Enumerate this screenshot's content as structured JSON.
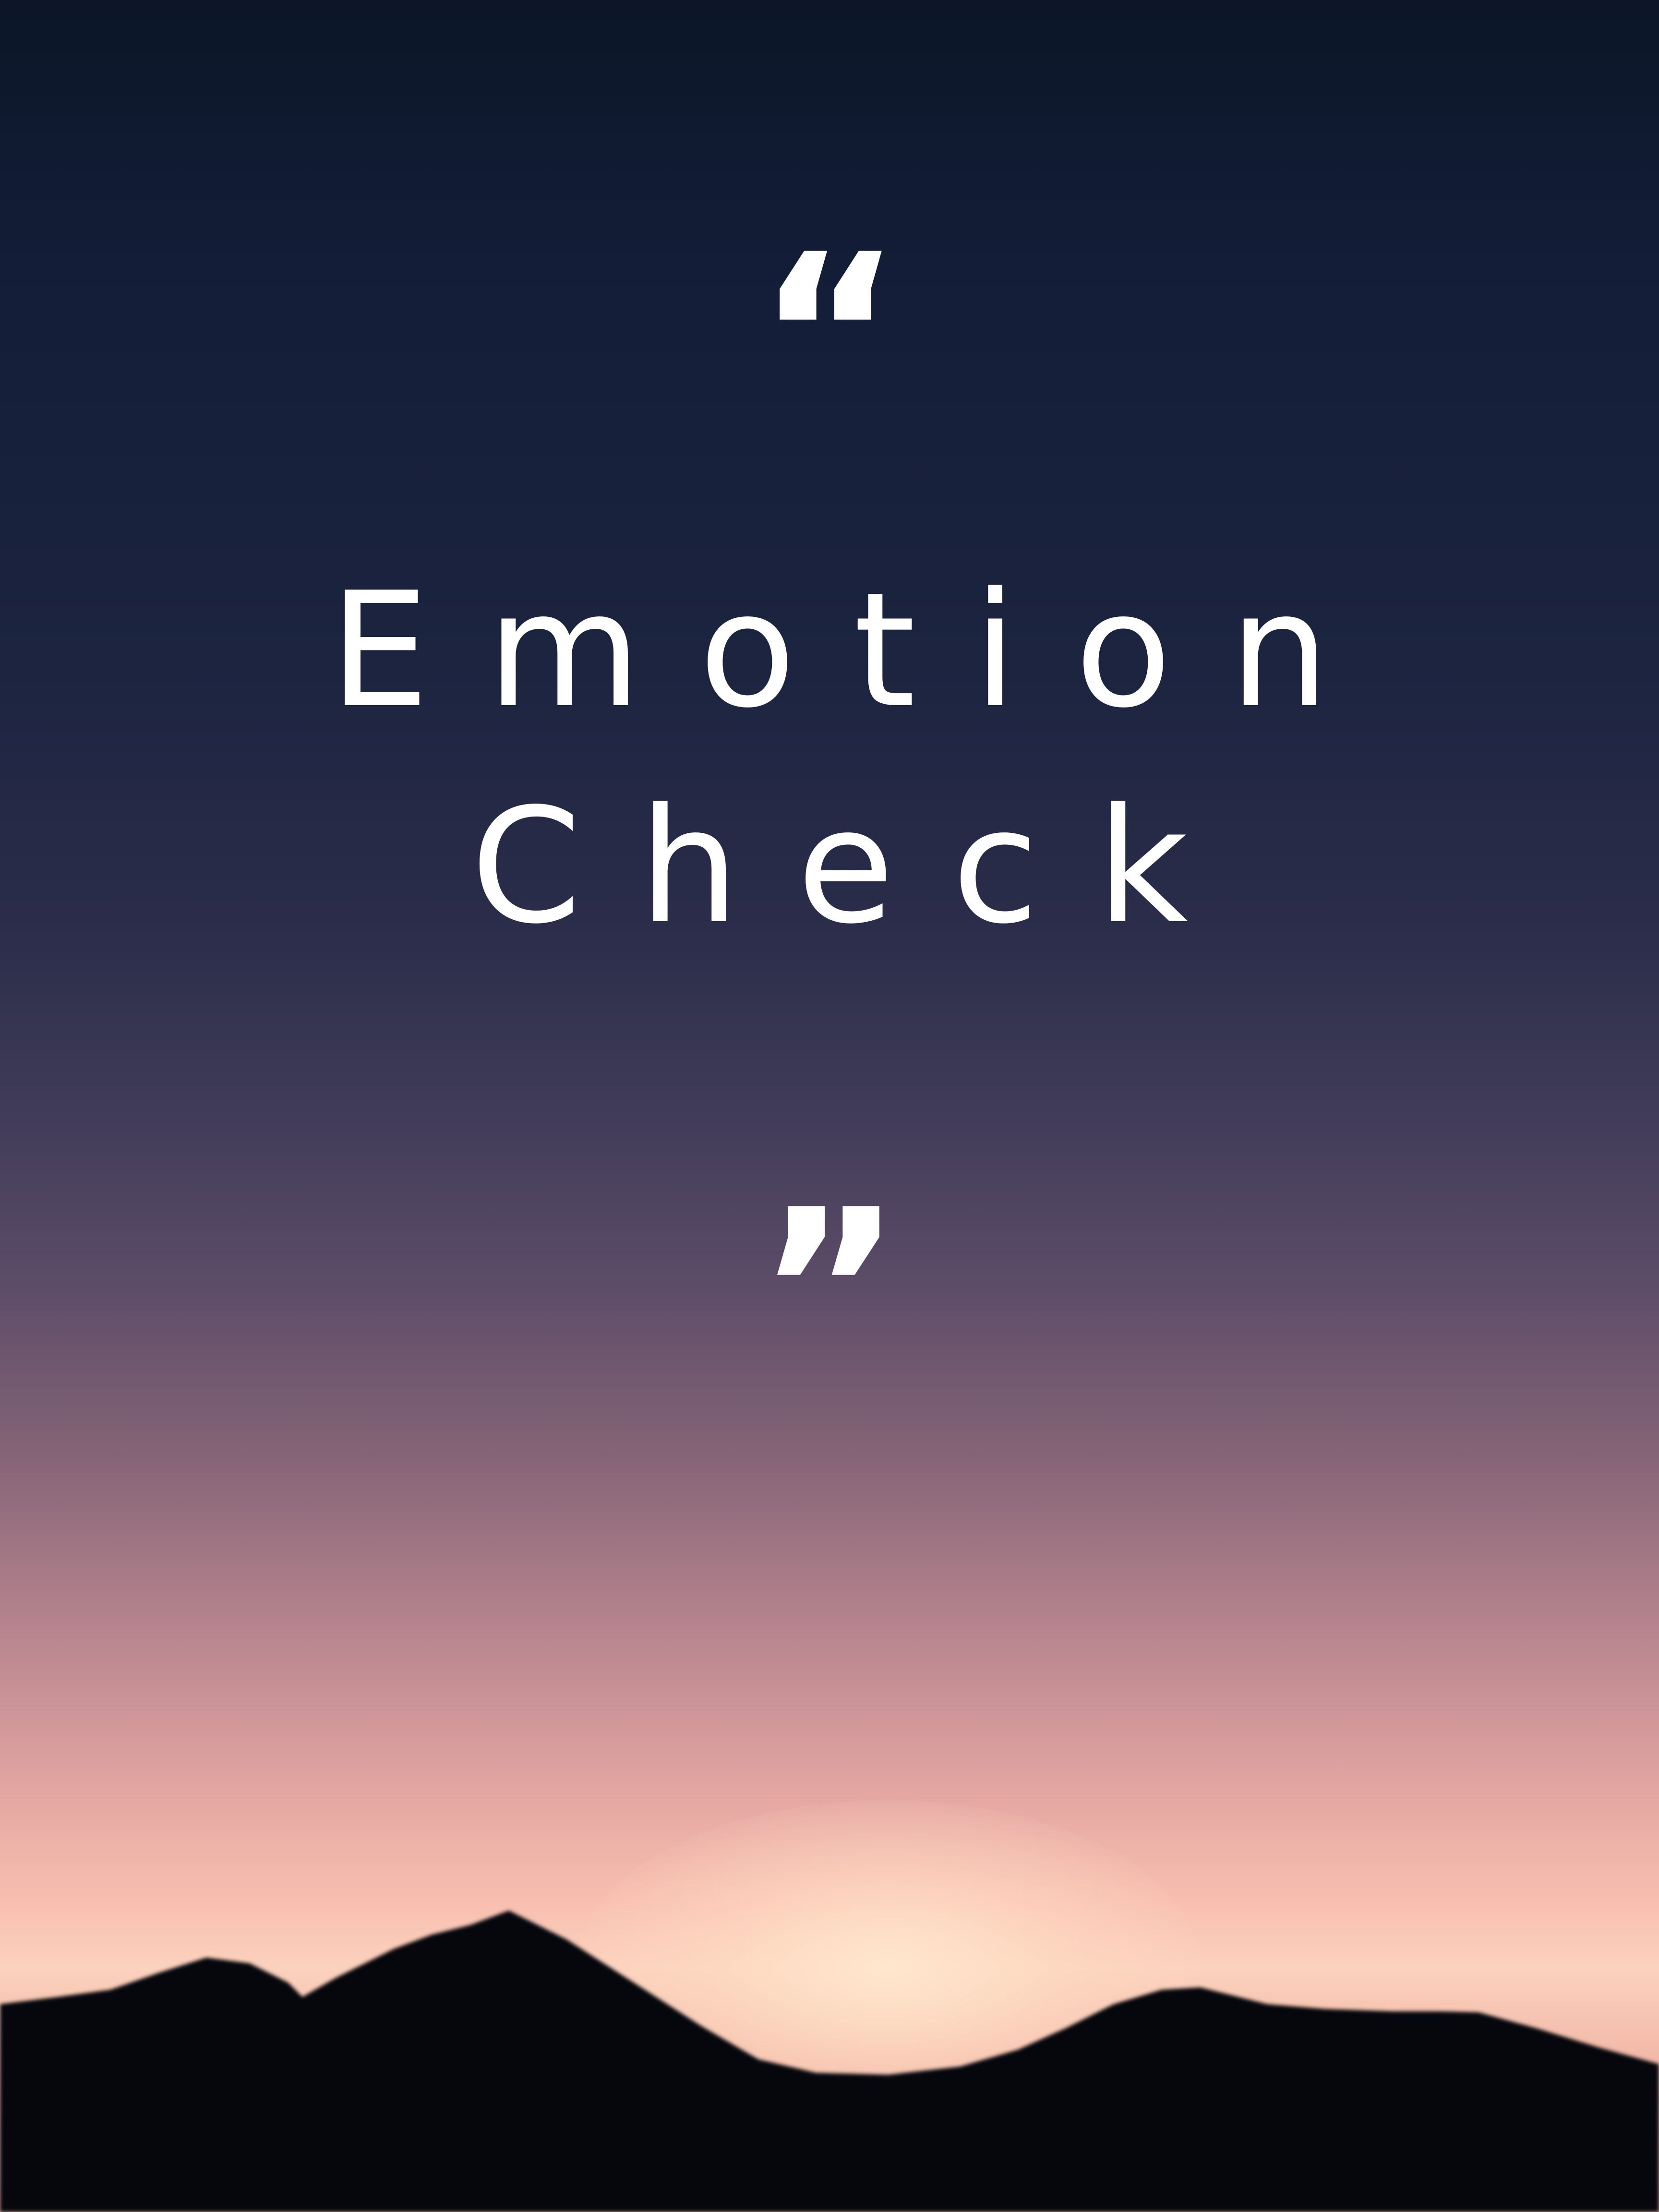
{
  "poster": {
    "open_quote": "“",
    "title_line_1": "Emotion",
    "title_line_2": "Check",
    "close_quote": "”"
  },
  "colors": {
    "sky_top": "#0c1628",
    "sky_mid": "#3f3b58",
    "horizon_glow": "#fbd2bd",
    "mountain_silhouette": "#05070d",
    "text": "#ffffff"
  }
}
